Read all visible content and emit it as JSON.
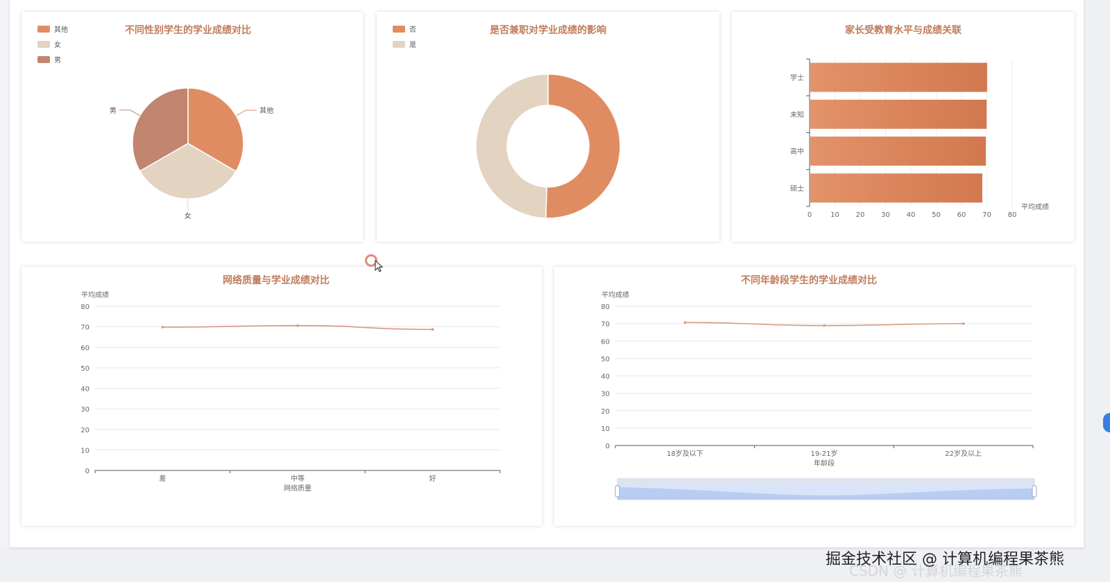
{
  "watermark": {
    "primary": "掘金技术社区 @ 计算机编程果茶熊",
    "secondary": "CSDN @ 计算机编程果茶熊"
  },
  "colors": {
    "orange": "#e08c62",
    "beige": "#e3d3c1",
    "brown": "#c18570",
    "bar": "#d97b52",
    "line": "#d99a7a",
    "title": "#c07c5c"
  },
  "chart_data": [
    {
      "type": "pie",
      "title": "不同性别学生的学业成绩对比",
      "legend": [
        "其他",
        "女",
        "男"
      ],
      "slices": [
        {
          "name": "其他",
          "value": 33.4,
          "color": "#e08c62"
        },
        {
          "name": "女",
          "value": 33.3,
          "color": "#e3d3c1"
        },
        {
          "name": "男",
          "value": 33.3,
          "color": "#c18570"
        }
      ]
    },
    {
      "type": "pie",
      "subtype": "donut",
      "title": "是否兼职对学业成绩的影响",
      "legend": [
        "否",
        "是"
      ],
      "slices": [
        {
          "name": "否",
          "value": 50.5,
          "color": "#e08c62"
        },
        {
          "name": "是",
          "value": 49.5,
          "color": "#e3d3c1"
        }
      ]
    },
    {
      "type": "bar",
      "orientation": "horizontal",
      "title": "家长受教育水平与成绩关联",
      "categories": [
        "学士",
        "未知",
        "高中",
        "硕士"
      ],
      "values": [
        70.1,
        69.9,
        69.6,
        68.2
      ],
      "xlabel": "平均成绩",
      "xlim": [
        0,
        80
      ],
      "xticks": [
        "0",
        "10",
        "20",
        "30",
        "40",
        "50",
        "60",
        "70",
        "80"
      ]
    },
    {
      "type": "line",
      "title": "网络质量与学业成绩对比",
      "categories": [
        "差",
        "中等",
        "好"
      ],
      "values": [
        69.8,
        70.6,
        68.7
      ],
      "xlabel": "网络质量",
      "ylabel": "平均成绩",
      "ylim": [
        0,
        80
      ],
      "yticks": [
        "0",
        "10",
        "20",
        "30",
        "40",
        "50",
        "60",
        "70",
        "80"
      ]
    },
    {
      "type": "line",
      "title": "不同年龄段学生的学业成绩对比",
      "categories": [
        "18岁及以下",
        "19-21岁",
        "22岁及以上"
      ],
      "values": [
        70.7,
        68.9,
        70.0
      ],
      "xlabel": "年龄段",
      "ylabel": "平均成绩",
      "ylim": [
        0,
        80
      ],
      "yticks": [
        "0",
        "10",
        "20",
        "30",
        "40",
        "50",
        "60",
        "70",
        "80"
      ],
      "datazoom": true
    }
  ]
}
